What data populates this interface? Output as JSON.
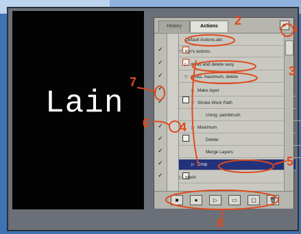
{
  "canvas": {
    "text": "Lain"
  },
  "palette": {
    "tabs": [
      {
        "label": "History"
      },
      {
        "label": "Actions"
      }
    ],
    "menu_button": "▸",
    "rows": [
      {
        "twisty": "",
        "label": "Default Actions.atn"
      },
      {
        "twisty": "▽",
        "label": "Kyr's actions"
      },
      {
        "twisty": "▷",
        "label": "drvas and delete sexy"
      },
      {
        "twisty": "▽",
        "label": "drvas, maximum, delete"
      },
      {
        "twisty": "▷",
        "label": "Make layer"
      },
      {
        "twisty": "▽",
        "label": "Stroke Work Path"
      },
      {
        "twisty": "",
        "label": "Using: paintbrush"
      },
      {
        "twisty": "▷",
        "label": "Maximum"
      },
      {
        "twisty": "",
        "label": "Delete"
      },
      {
        "twisty": "",
        "label": "Merge Layers"
      },
      {
        "twisty": "▷",
        "label": "Crop"
      },
      {
        "twisty": "▷",
        "label": "mash"
      }
    ],
    "bottom_buttons": [
      {
        "name": "stop-button",
        "glyph": "■"
      },
      {
        "name": "record-button",
        "glyph": "●"
      },
      {
        "name": "play-button",
        "glyph": "▷"
      },
      {
        "name": "new-set-button",
        "glyph": "▭"
      },
      {
        "name": "new-action-button",
        "glyph": "▢"
      },
      {
        "name": "delete-button",
        "glyph": "🗑"
      }
    ]
  },
  "annotations": {
    "n2": "2",
    "n1": "1",
    "n3": "3",
    "n4": "4",
    "n5": "5",
    "n6": "6",
    "n7": "7",
    "n8": "8"
  },
  "colors": {
    "annotation": "#e04a1c",
    "selection": "#23327a",
    "canvas": "#030303"
  }
}
